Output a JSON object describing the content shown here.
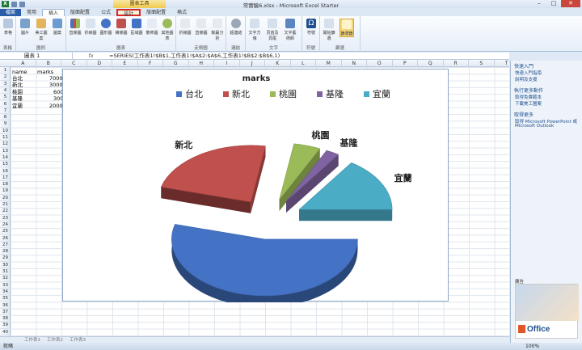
{
  "window": {
    "title": "常實驗6.xlsx - Microsoft Excel Starter",
    "chart_tools_label": "圖表工具"
  },
  "tabs": [
    "檔案",
    "常用",
    "插入",
    "版面配置",
    "公式",
    "設計",
    "版面配置",
    "格式"
  ],
  "ribbon": {
    "groups": [
      {
        "label": "表格",
        "buttons": [
          "表格"
        ]
      },
      {
        "label": "圖例",
        "buttons": [
          "圖片",
          "美工圖案",
          "圖案"
        ]
      },
      {
        "label": "圖表",
        "buttons": [
          "直條圖",
          "折線圖",
          "圓形圖",
          "橫條圖",
          "區域圖",
          "散佈圖",
          "其他圖表"
        ]
      },
      {
        "label": "走勢圖",
        "buttons": [
          "折線圖",
          "直條圖",
          "輸贏分析"
        ]
      },
      {
        "label": "連結",
        "buttons": [
          "超連結"
        ]
      },
      {
        "label": "文字",
        "buttons": [
          "文字方塊",
          "頁首及頁尾",
          "文字藝術師"
        ]
      },
      {
        "label": "符號",
        "buttons": [
          "符號"
        ]
      },
      {
        "label": "篩選",
        "buttons": [
          "開始篩選",
          "篩選器"
        ]
      }
    ]
  },
  "formula_bar": {
    "name_box": "圖表 1",
    "fx": "fx",
    "formula": "=SERIES(工作表1!$B$1,工作表1!$A$2:$A$6,工作表1!$B$2:$B$6,1)"
  },
  "columns": [
    "A",
    "B",
    "C",
    "D",
    "E",
    "F",
    "G",
    "H",
    "I",
    "J",
    "K",
    "L",
    "M",
    "N",
    "O",
    "P",
    "Q",
    "R",
    "S",
    "T"
  ],
  "rows": [
    "1",
    "2",
    "3",
    "4",
    "5",
    "6",
    "7",
    "8",
    "9",
    "10",
    "11",
    "12",
    "13",
    "14",
    "15",
    "16",
    "17",
    "18",
    "19",
    "20",
    "21",
    "22",
    "23",
    "24",
    "25",
    "26",
    "27",
    "28",
    "29",
    "30",
    "31",
    "32",
    "33",
    "34",
    "35",
    "36",
    "37",
    "38",
    "39",
    "40"
  ],
  "cells": {
    "a1": "name",
    "b1": "marks",
    "a2": "台北",
    "b2": "7000",
    "a3": "新北",
    "b3": "3000",
    "a4": "桃園",
    "b4": "600",
    "a5": "基隆",
    "b5": "300",
    "a6": "宜蘭",
    "b6": "2000"
  },
  "chart_data": {
    "type": "pie",
    "title": "marks",
    "categories": [
      "台北",
      "新北",
      "桃園",
      "基隆",
      "宜蘭"
    ],
    "values": [
      7000,
      3000,
      600,
      300,
      2000
    ],
    "colors": [
      "#4472c4",
      "#c0504d",
      "#9bbb59",
      "#8064a2",
      "#4bacc6"
    ],
    "legend": "top",
    "exploded": true,
    "three_d": true
  },
  "sheet_tabs": [
    "工作表1",
    "工作表2",
    "工作表3"
  ],
  "status": {
    "left": "就緒",
    "zoom": "100%"
  },
  "task_pane": {
    "section1": "快速入門",
    "links1": [
      "快速入門指南",
      "說明及支援"
    ],
    "section2": "執行更多動作",
    "links2": [
      "取得免費範本",
      "下載美工圖案"
    ],
    "section3": "取得更多",
    "links3": [
      "取得 Microsoft PowerPoint 或",
      "Microsoft Outlook"
    ],
    "ad_label": "廣告",
    "ad_brand": "Office"
  }
}
